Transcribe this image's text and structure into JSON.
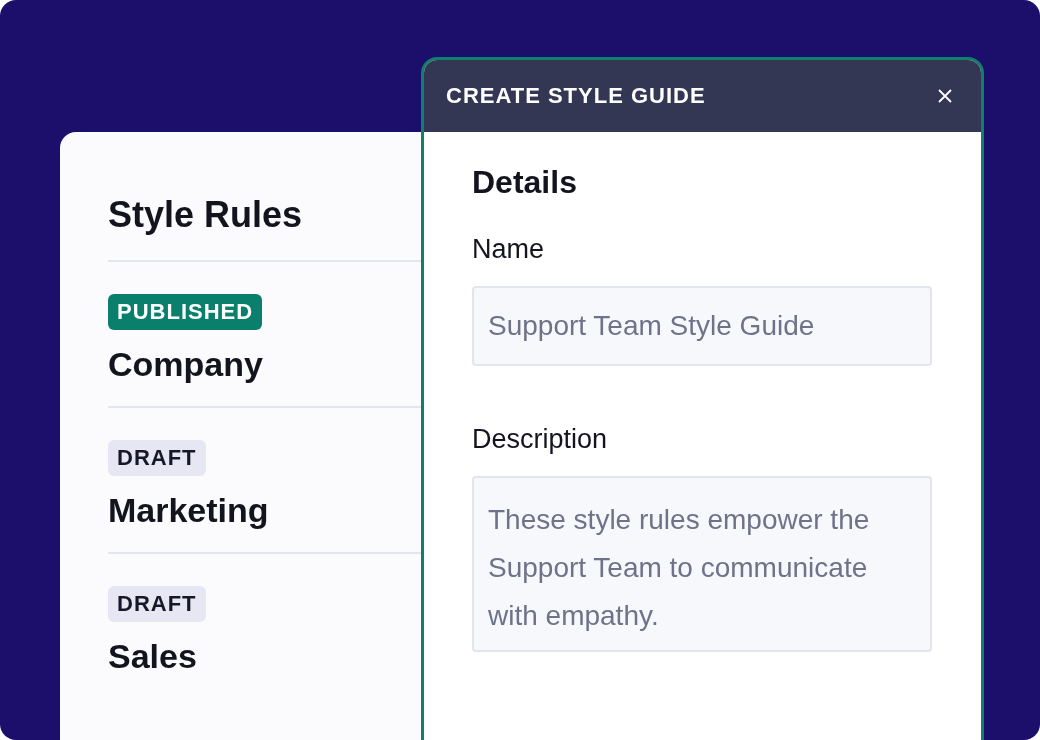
{
  "style_rules": {
    "title": "Style Rules",
    "items": [
      {
        "status": "PUBLISHED",
        "kind": "published",
        "name": "Company"
      },
      {
        "status": "DRAFT",
        "kind": "draft",
        "name": "Marketing"
      },
      {
        "status": "DRAFT",
        "kind": "draft",
        "name": "Sales"
      }
    ]
  },
  "dialog": {
    "title": "CREATE STYLE GUIDE",
    "section": "Details",
    "fields": [
      {
        "label": "Name",
        "kind": "input",
        "placeholder": "Support Team Style Guide"
      },
      {
        "label": "Description",
        "kind": "textarea",
        "placeholder": "These style rules empower the Support Team to communicate with empathy."
      }
    ]
  }
}
